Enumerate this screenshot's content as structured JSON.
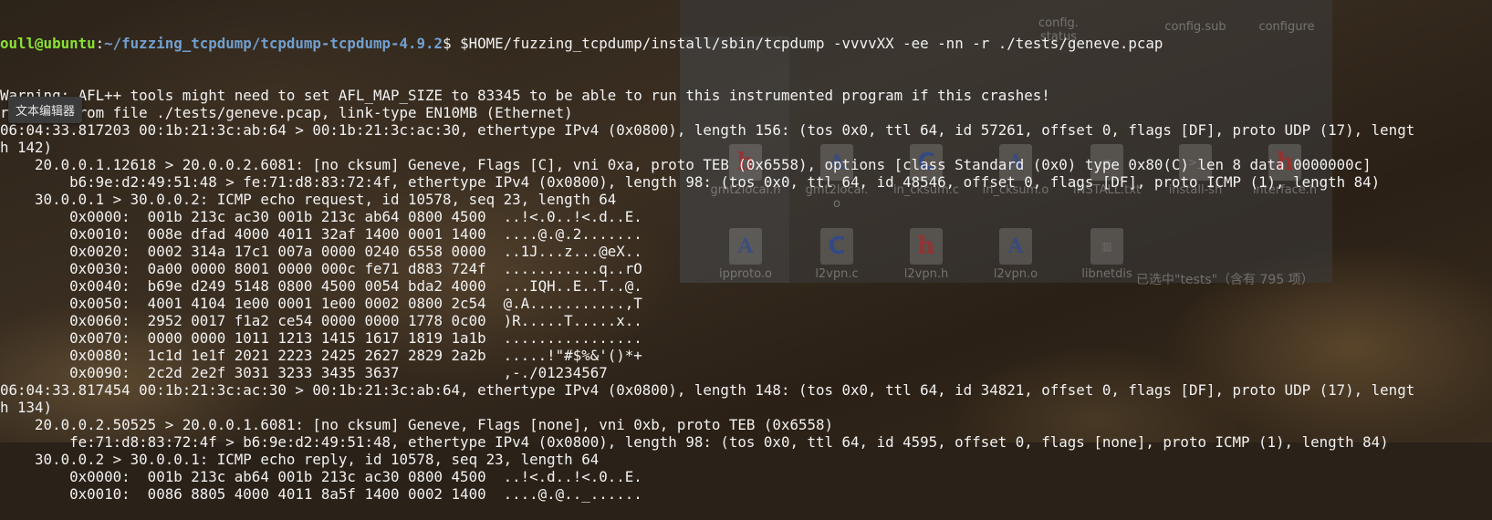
{
  "terminal": {
    "prompt": {
      "user_host": "oull@ubuntu",
      "path": "~/fuzzing_tcpdump/tcpdump-tcpdump-4.9.2",
      "symbol": "$",
      "command": " $HOME/fuzzing_tcpdump/install/sbin/tcpdump -vvvvXX -ee -nn -r ./tests/geneve.pcap"
    },
    "lines": [
      "Warning: AFL++ tools might need to set AFL_MAP_SIZE to 83345 to be able to run this instrumented program if this crashes!",
      "reading from file ./tests/geneve.pcap, link-type EN10MB (Ethernet)",
      "06:04:33.817203 00:1b:21:3c:ab:64 > 00:1b:21:3c:ac:30, ethertype IPv4 (0x0800), length 156: (tos 0x0, ttl 64, id 57261, offset 0, flags [DF], proto UDP (17), lengt",
      "h 142)",
      "    20.0.0.1.12618 > 20.0.0.2.6081: [no cksum] Geneve, Flags [C], vni 0xa, proto TEB (0x6558), options [class Standard (0x0) type 0x80(C) len 8 data 0000000c]",
      "        b6:9e:d2:49:51:48 > fe:71:d8:83:72:4f, ethertype IPv4 (0x0800), length 98: (tos 0x0, ttl 64, id 48546, offset 0, flags [DF], proto ICMP (1), length 84)",
      "    30.0.0.1 > 30.0.0.2: ICMP echo request, id 10578, seq 23, length 64",
      "        0x0000:  001b 213c ac30 001b 213c ab64 0800 4500  ..!<.0..!<.d..E.",
      "        0x0010:  008e dfad 4000 4011 32af 1400 0001 1400  ....@.@.2.......",
      "        0x0020:  0002 314a 17c1 007a 0000 0240 6558 0000  ..1J...z...@eX..",
      "        0x0030:  0a00 0000 8001 0000 000c fe71 d883 724f  ...........q..rO",
      "        0x0040:  b69e d249 5148 0800 4500 0054 bda2 4000  ...IQH..E..T..@.",
      "        0x0050:  4001 4104 1e00 0001 1e00 0002 0800 2c54  @.A...........,T",
      "        0x0060:  2952 0017 f1a2 ce54 0000 0000 1778 0c00  )R.....T.....x..",
      "        0x0070:  0000 0000 1011 1213 1415 1617 1819 1a1b  ................",
      "        0x0080:  1c1d 1e1f 2021 2223 2425 2627 2829 2a2b  .....!\"#$%&'()*+",
      "        0x0090:  2c2d 2e2f 3031 3233 3435 3637            ,-./01234567",
      "06:04:33.817454 00:1b:21:3c:ac:30 > 00:1b:21:3c:ab:64, ethertype IPv4 (0x0800), length 148: (tos 0x0, ttl 64, id 34821, offset 0, flags [DF], proto UDP (17), lengt",
      "h 134)",
      "    20.0.0.2.50525 > 20.0.0.1.6081: [no cksum] Geneve, Flags [none], vni 0xb, proto TEB (0x6558)",
      "        fe:71:d8:83:72:4f > b6:9e:d2:49:51:48, ethertype IPv4 (0x0800), length 98: (tos 0x0, ttl 64, id 4595, offset 0, flags [none], proto ICMP (1), length 84)",
      "    30.0.0.2 > 30.0.0.1: ICMP echo reply, id 10578, seq 23, length 64",
      "        0x0000:  001b 213c ab64 001b 213c ac30 0800 4500  ..!<.d..!<.0..E.",
      "        0x0010:  0086 8805 4000 4011 8a5f 1400 0002 1400  ....@.@.._......"
    ]
  },
  "tooltip": "文本编辑器",
  "file_manager": {
    "status": "已选中\"tests\"（含有 795 项）",
    "items": [
      {
        "label": "config.\nstatus",
        "icon": "text-file-icon"
      },
      {
        "label": "config.sub",
        "icon": "text-file-icon"
      },
      {
        "label": "configure",
        "icon": "text-file-icon"
      },
      {
        "label": "gmt2local.h",
        "icon": "h-file-icon"
      },
      {
        "label": "gmt2local.\no",
        "icon": "object-file-icon"
      },
      {
        "label": "in_cksum.c",
        "icon": "c-file-icon"
      },
      {
        "label": "in_cksum.o",
        "icon": "object-file-icon"
      },
      {
        "label": "INSTALL.txt",
        "icon": "text-file-icon"
      },
      {
        "label": "install-sh",
        "icon": "script-file-icon"
      },
      {
        "label": "interface.h",
        "icon": "h-file-icon"
      },
      {
        "label": "ipproto.o",
        "icon": "object-file-icon"
      },
      {
        "label": "l2vpn.c",
        "icon": "c-file-icon"
      },
      {
        "label": "l2vpn.h",
        "icon": "h-file-icon"
      },
      {
        "label": "l2vpn.o",
        "icon": "object-file-icon"
      },
      {
        "label": "libnetdis",
        "icon": "archive-file-icon"
      }
    ]
  }
}
